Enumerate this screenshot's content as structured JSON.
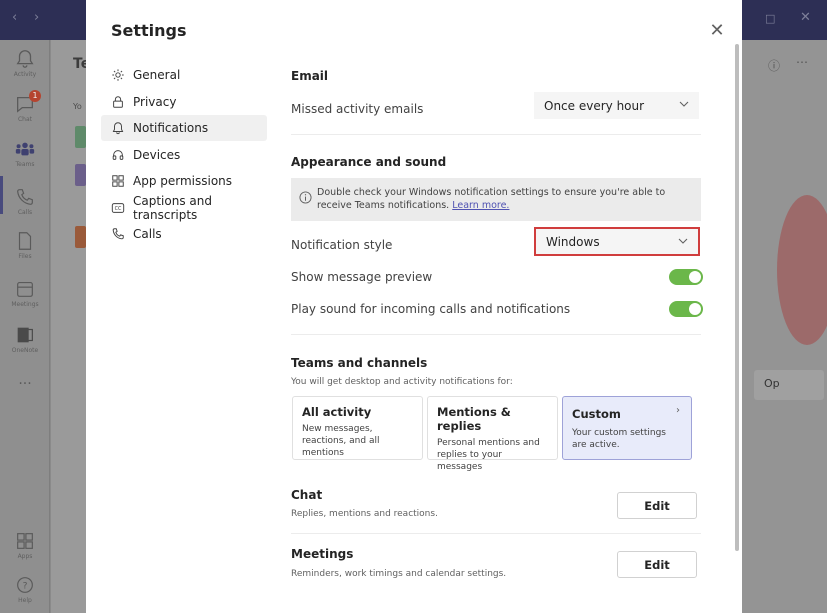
{
  "rail": {
    "items": [
      {
        "label": "Activity",
        "icon": "bell-icon"
      },
      {
        "label": "Chat",
        "icon": "chat-icon",
        "badge": "1"
      },
      {
        "label": "Teams",
        "icon": "teams-icon"
      },
      {
        "label": "Calls",
        "icon": "phone-icon"
      },
      {
        "label": "Files",
        "icon": "file-icon"
      },
      {
        "label": "Meetings",
        "icon": "calendar-icon"
      },
      {
        "label": "OneNote",
        "icon": "onenote-icon"
      },
      {
        "label": "...",
        "icon": "more-icon"
      },
      {
        "label": "Apps",
        "icon": "apps-icon"
      },
      {
        "label": "Help",
        "icon": "help-icon"
      }
    ]
  },
  "background": {
    "header_fragment": "Te",
    "list_fragment": "Yo",
    "right_button_fragment": "Op"
  },
  "dialog": {
    "title": "Settings",
    "nav": [
      {
        "label": "General",
        "icon": "gear-icon"
      },
      {
        "label": "Privacy",
        "icon": "lock-icon"
      },
      {
        "label": "Notifications",
        "icon": "bell-icon",
        "active": true
      },
      {
        "label": "Devices",
        "icon": "headset-icon"
      },
      {
        "label": "App permissions",
        "icon": "grid-icon"
      },
      {
        "label": "Captions and transcripts",
        "icon": "cc-icon"
      },
      {
        "label": "Calls",
        "icon": "phone-icon"
      }
    ]
  },
  "email": {
    "title": "Email",
    "missed_label": "Missed activity emails",
    "missed_value": "Once every hour"
  },
  "appearance": {
    "title": "Appearance and sound",
    "info_text": "Double check your Windows notification settings to ensure you're able to receive Teams notifications.",
    "info_link": "Learn more.",
    "style_label": "Notification style",
    "style_value": "Windows",
    "preview_label": "Show message preview",
    "preview_on": true,
    "sound_label": "Play sound for incoming calls and notifications",
    "sound_on": true
  },
  "teams_channels": {
    "title": "Teams and channels",
    "subtitle": "You will get desktop and activity notifications for:",
    "cards": [
      {
        "title": "All activity",
        "desc": "New messages, reactions, and all mentions"
      },
      {
        "title": "Mentions & replies",
        "desc": "Personal mentions and replies to your messages"
      },
      {
        "title": "Custom",
        "desc": "Your custom settings are active.",
        "selected": true
      }
    ]
  },
  "chat": {
    "title": "Chat",
    "subtitle": "Replies, mentions and reactions.",
    "button": "Edit"
  },
  "meetings": {
    "title": "Meetings",
    "subtitle": "Reminders, work timings and calendar settings.",
    "button": "Edit"
  },
  "colors": {
    "accent": "#4f52b2",
    "toggle_on": "#6bb74a",
    "highlight": "#d03d3d",
    "titlebar": "#2d2f55"
  }
}
